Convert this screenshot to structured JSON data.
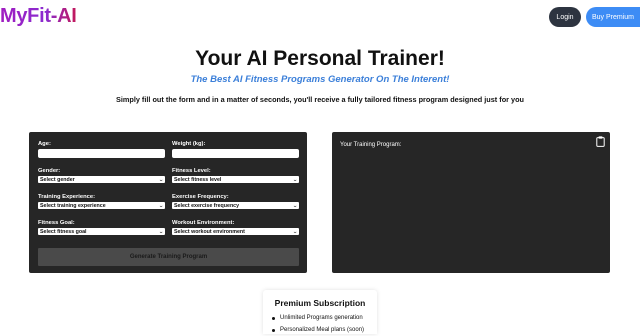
{
  "header": {
    "logo": "MyFit-AI",
    "login_label": "Login",
    "premium_label": "Buy Premium"
  },
  "hero": {
    "title": "Your AI Personal Trainer!",
    "subtitle": "The Best AI Fitness Programs Generator On The Interent!",
    "description": "Simply fill out the form and in a matter of seconds, you'll receive a fully tailored fitness program designed just for you"
  },
  "form": {
    "age_label": "Age:",
    "age_value": "",
    "weight_label": "Weight (kg):",
    "weight_value": "",
    "gender_label": "Gender:",
    "gender_selected": "Select gender",
    "fitness_level_label": "Fitness Level:",
    "fitness_level_selected": "Select fitness level",
    "experience_label": "Training Experience:",
    "experience_selected": "Select training experience",
    "frequency_label": "Exercise Frequency:",
    "frequency_selected": "Select exercise frequency",
    "goal_label": "Fitness Goal:",
    "goal_selected": "Select fitness goal",
    "environment_label": "Workout Environment:",
    "environment_selected": "Select workout environment",
    "generate_label": "Generate Training Program"
  },
  "result": {
    "label": "Your Training Program:",
    "copy_icon": "clipboard-icon"
  },
  "subscription": {
    "title": "Premium Subscription",
    "features": [
      "Unlimited Programs generation",
      "Personalized Meal plans (soon)"
    ]
  },
  "colors": {
    "panel_bg": "#262626",
    "accent_blue": "#3b7fd9",
    "premium_button": "#3d8cf5",
    "login_button": "#2d3440",
    "logo_purple": "#9b1fb1"
  }
}
